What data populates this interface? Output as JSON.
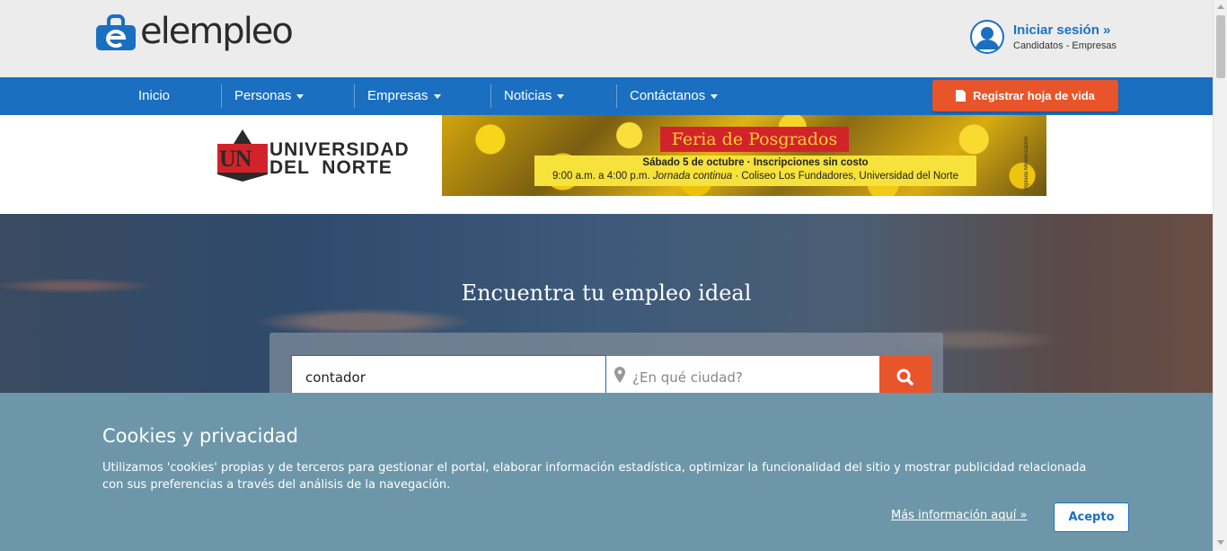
{
  "header": {
    "logo_text": "elempleo",
    "login_link": "Iniciar sesión »",
    "login_sub": "Candidatos - Empresas"
  },
  "nav": {
    "items": [
      {
        "label": "Inicio",
        "has_dropdown": false
      },
      {
        "label": "Personas",
        "has_dropdown": true
      },
      {
        "label": "Empresas",
        "has_dropdown": true
      },
      {
        "label": "Noticias",
        "has_dropdown": true
      },
      {
        "label": "Contáctanos",
        "has_dropdown": true
      }
    ],
    "cta_label": "Registrar hoja de vida"
  },
  "banner": {
    "university_line1": "UNIVERSIDAD",
    "university_line2": "DEL  NORTE",
    "un_mark": "UN",
    "ad_title": "Feria de Posgrados",
    "ad_line1": "Sábado 5 de octubre · Inscripciones sin costo",
    "ad_line2_prefix": "9:00 a.m. a 4:00 p.m. ",
    "ad_line2_italic": "Jornada continua",
    "ad_line2_suffix": " · Coliseo Los Fundadores, Universidad del Norte",
    "ad_side_text": "Vigilada Mineducación"
  },
  "hero": {
    "title": "Encuentra tu empleo ideal",
    "search_value": "contador",
    "city_placeholder": "¿En qué ciudad?"
  },
  "cookie": {
    "title": "Cookies y privacidad",
    "body": "Utilizamos 'cookies' propias y de terceros para gestionar el portal, elaborar información estadística, optimizar la funcionalidad del sitio y mostrar publicidad relacionada con sus preferencias a través del análisis de la navegación.",
    "more_link": "Más información aquí »",
    "accept_label": "Acepto"
  },
  "colors": {
    "brand_blue": "#1a6fc1",
    "cta_orange": "#e8552a",
    "cookie_bg": "#6d97a9"
  }
}
